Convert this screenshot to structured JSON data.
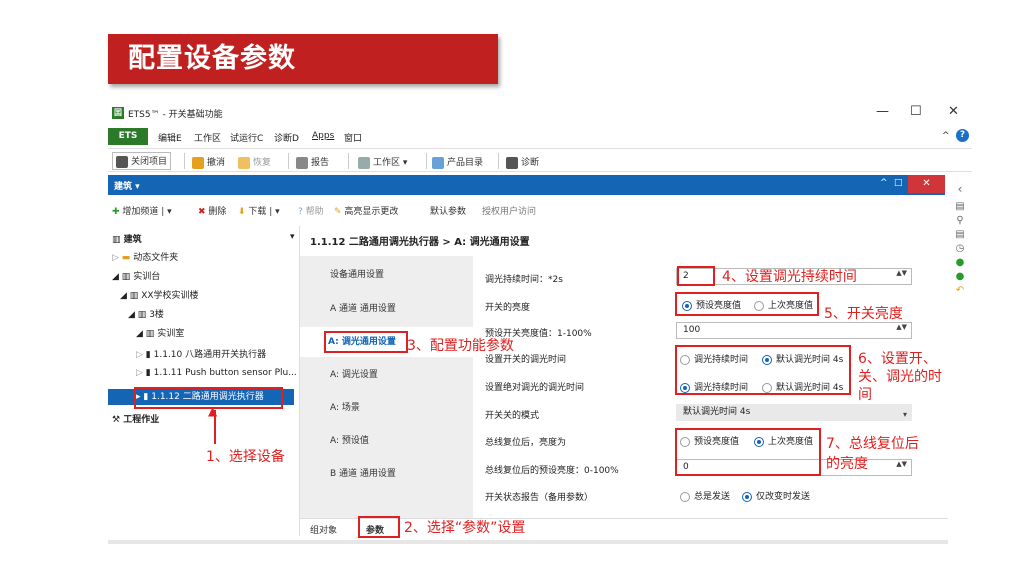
{
  "slide": {
    "title": "配置设备参数"
  },
  "window": {
    "logo": "囯",
    "title": "ETS5™ - 开关基础功能",
    "minimize": "—",
    "maximize": "☐",
    "close": "✕"
  },
  "menubar": {
    "ets": "ETS",
    "items": [
      "编辑E",
      "工作区",
      "试运行C",
      "诊断D",
      "Apps",
      "窗口"
    ],
    "collapse": "^",
    "help": "?"
  },
  "toolbar": {
    "items": [
      "关闭项目",
      "撤消",
      "恢复",
      "报告",
      "工作区 ▾",
      "产品目录",
      "诊断"
    ]
  },
  "bluebar": {
    "label": "建筑 ▾",
    "ctrl_up": "^",
    "ctrl_box": "□",
    "close": "✕",
    "side_arrow": "‹"
  },
  "actionbar": {
    "items": [
      "增加频道 | ▾",
      "删除",
      "下载 | ▾",
      "帮助",
      "高亮显示更改",
      "默认参数",
      "授权用户访问"
    ]
  },
  "tree": {
    "header": "建筑",
    "header_arrow": "▾",
    "items": [
      {
        "label": "动态文件夹"
      },
      {
        "label": "实训台"
      },
      {
        "label": "XX学校实训楼"
      },
      {
        "label": "3楼"
      },
      {
        "label": "实训室"
      },
      {
        "label": "1.1.10 八路通用开关执行器"
      },
      {
        "label": "1.1.11 Push button sensor Plu..."
      },
      {
        "label": "1.1.12 二路通用调光执行器"
      }
    ],
    "work": "工程作业"
  },
  "panel": {
    "title": "1.1.12 二路通用调光执行器 > A: 调光通用设置",
    "tabs": [
      "设备通用设置",
      "A 通道 通用设置",
      "A: 调光通用设置",
      "A: 调光设置",
      "A: 场景",
      "A: 预设值",
      "B 通道 通用设置"
    ],
    "bottom_tabs": [
      "组对象",
      "参数"
    ]
  },
  "params": {
    "p1": {
      "label": "调光持续时间：*2s",
      "value": "2"
    },
    "p2": {
      "label": "开关的亮度",
      "opt1": "预设亮度值",
      "opt2": "上次亮度值"
    },
    "p3": {
      "label": "预设开关亮度值：1-100%",
      "value": "100"
    },
    "p4": {
      "label": "设置开关的调光时间",
      "opt1": "调光持续时间",
      "opt2": "默认调光时间 4s"
    },
    "p5": {
      "label": "设置绝对调光的调光时间",
      "opt1": "调光持续时间",
      "opt2": "默认调光时间 4s"
    },
    "p6": {
      "label": "开关关的模式",
      "value": "默认调光时间 4s"
    },
    "p7": {
      "label": "总线复位后，亮度为",
      "opt1": "预设亮度值",
      "opt2": "上次亮度值"
    },
    "p8": {
      "label": "总线复位后的预设亮度：0-100%",
      "value": "0"
    },
    "p9": {
      "label": "开关状态报告（备用参数）",
      "opt1": "总是发送",
      "opt2": "仅改变时发送"
    }
  },
  "annotations": {
    "a1": "1、选择设备",
    "a2": "2、选择“参数”设置",
    "a3": "3、配置功能参数",
    "a4": "4、设置调光持续时间",
    "a5": "5、开关亮度",
    "a6": [
      "6、设置开、",
      "关、调光的时",
      "间"
    ],
    "a7": [
      "7、总线复位后",
      "的亮度"
    ]
  },
  "icons": {
    "spin": "▲▼",
    "dropdown": "▾",
    "plus": "✚",
    "delete": "✖",
    "download": "⬇",
    "help": "?",
    "highlight": "✎",
    "folder": "▬",
    "expand_open": "◢",
    "expand_closed": "▷",
    "expand_selected": "▸",
    "device": "▮",
    "building": "▥",
    "tools": "⚒",
    "arrow_up": "▲",
    "strip": [
      "▤",
      "⚲",
      "▤",
      "◷",
      "●",
      "●",
      "↶"
    ]
  },
  "colors": {
    "accent": "#1565b5",
    "brand": "#2a7a2a",
    "annotation": "#e02020",
    "slide_title": "#c0201f"
  }
}
